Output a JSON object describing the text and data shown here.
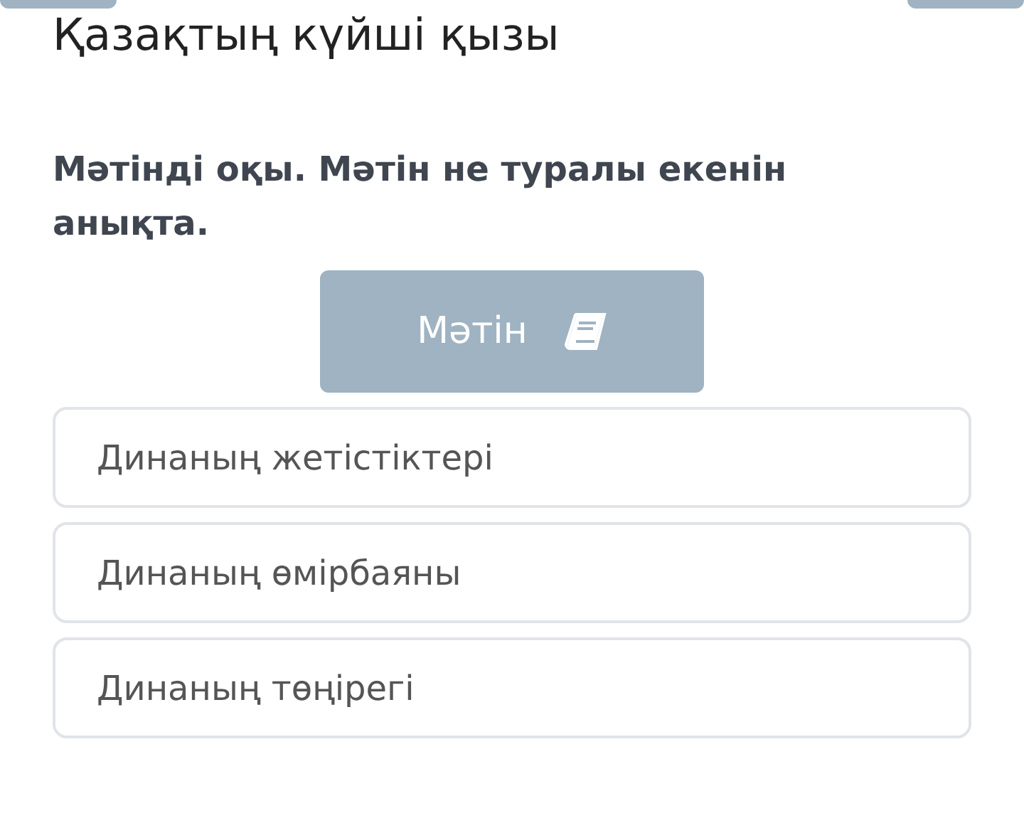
{
  "title": "Қазақтың күйші қызы",
  "question": "Мәтінді оқы. Мәтін не туралы екенін анықта.",
  "text_button": {
    "label": "Мәтін"
  },
  "options": [
    {
      "label": "Динаның жетістіктері",
      "selected": false
    },
    {
      "label": "Динаның өмірбаяны",
      "selected": false
    },
    {
      "label": "Динаның төңірегі",
      "selected": false
    }
  ]
}
